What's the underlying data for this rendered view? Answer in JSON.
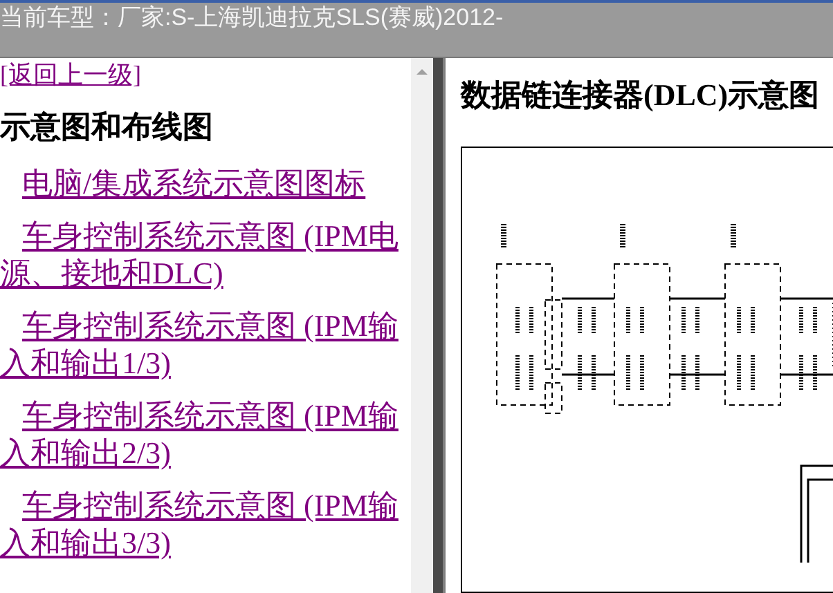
{
  "title_bar": {
    "text": "当前车型：厂家:S-上海凯迪拉克SLS(赛威)2012-"
  },
  "sidebar": {
    "back_link": "[返回上一级]",
    "heading": "示意图和布线图",
    "items": [
      {
        "label": "电脑/集成系统示意图图标"
      },
      {
        "label": "车身控制系统示意图 (IPM电源、接地和DLC)"
      },
      {
        "label": "车身控制系统示意图 (IPM输入和输出1/3)"
      },
      {
        "label": "车身控制系统示意图 (IPM输入和输出2/3)"
      },
      {
        "label": "车身控制系统示意图 (IPM输入和输出3/3)"
      }
    ]
  },
  "content": {
    "title": "数据链连接器(DLC)示意图"
  }
}
